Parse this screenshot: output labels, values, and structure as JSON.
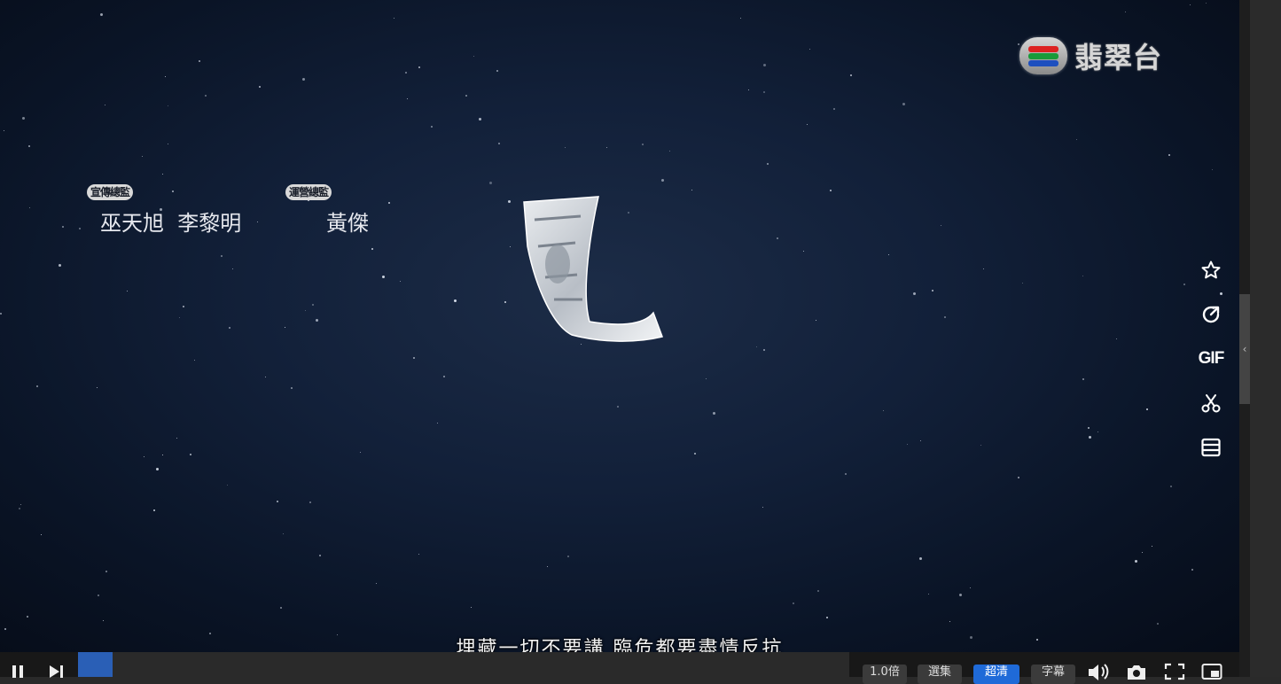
{
  "player": {
    "channel_logo_text": "翡翠台",
    "credits": [
      {
        "role": "宣傳總監",
        "names": "巫天旭  李黎明"
      },
      {
        "role": "運營總監",
        "names": "黃傑"
      }
    ],
    "subtitle": "埋藏一切不要講 臨危都要盡情反抗",
    "progress_fraction": 0.045,
    "buffered_fraction": 0.045
  },
  "side_tools": {
    "gif_label": "GIF"
  },
  "controls": {
    "speed_label": "1.0倍",
    "episodes_label": "選集",
    "quality_label": "超清",
    "subtitles_label": "字幕"
  },
  "icons": {
    "favorite": "star-icon",
    "share": "share-icon",
    "clip": "scissors-icon",
    "list": "list-icon",
    "play_pause": "pause-icon",
    "next": "next-icon",
    "volume": "volume-icon",
    "screenshot": "camera-icon",
    "fullscreen": "fullscreen-icon",
    "pip": "picture-in-picture-icon"
  },
  "colors": {
    "accent": "#1f6ad8",
    "background": "#0a1426"
  }
}
